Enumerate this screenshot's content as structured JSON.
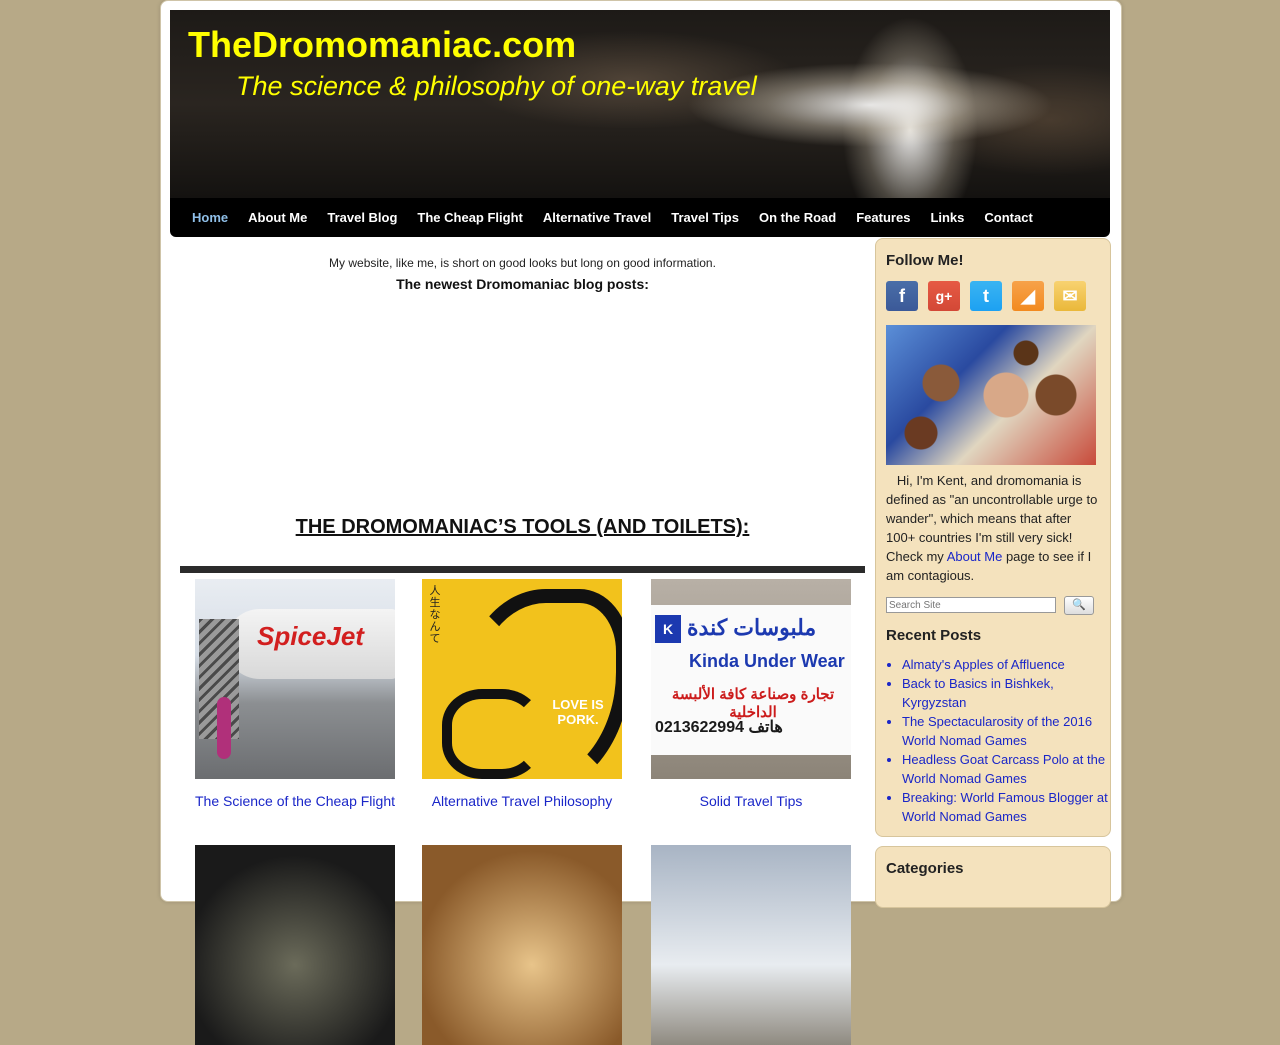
{
  "header": {
    "title": "TheDromomaniac.com",
    "tagline": "The science & philosophy of one-way travel"
  },
  "nav": {
    "items": [
      "Home",
      "About Me",
      "Travel Blog",
      "The Cheap Flight",
      "Alternative Travel",
      "Travel Tips",
      "On the Road",
      "Features",
      "Links",
      "Contact"
    ],
    "active": "Home"
  },
  "main": {
    "intro": "My website, like me, is short on good looks but long on good information.",
    "newest": "The newest Dromomaniac blog posts:",
    "tools_heading": "THE DROMOMANIAC’S TOOLS (AND TOILETS):",
    "tiles": [
      {
        "caption": "The Science of the Cheap Flight",
        "image_text": "SpiceJet"
      },
      {
        "caption": "Alternative Travel Philosophy",
        "image_text": "LOVE IS PORK."
      },
      {
        "caption": "Solid Travel Tips",
        "image_text": "Kinda Under Wear",
        "image_arabic": "ملبوسات كندة",
        "image_arabic2": "تجارة وصناعة كافة الألبسة الداخلية",
        "image_phone": "0213622994  هاتف"
      }
    ]
  },
  "sidebar": {
    "follow_title": "Follow Me!",
    "social": [
      {
        "icon": "facebook-icon",
        "glyph": "f"
      },
      {
        "icon": "google-plus-icon",
        "glyph": "g+"
      },
      {
        "icon": "twitter-icon",
        "glyph": "t"
      },
      {
        "icon": "rss-icon",
        "glyph": "◢"
      },
      {
        "icon": "email-icon",
        "glyph": "✉"
      }
    ],
    "bio_before": "Hi, I'm Kent, and dromomania is defined as \"an uncontrollable urge to wander\", which means that after 100+ countries I'm still very sick! Check my ",
    "bio_link": "About Me",
    "bio_after": " page to see if I am contagious.",
    "search_placeholder": "Search Site",
    "recent_title": "Recent Posts",
    "recent_posts": [
      "Almaty's Apples of Affluence",
      "Back to Basics in Bishkek, Kyrgyzstan",
      "The Spectacularosity of the 2016 World Nomad Games",
      "Headless Goat Carcass Polo at the World Nomad Games",
      "Breaking: World Famous Blogger at World Nomad Games"
    ],
    "categories_title": "Categories"
  }
}
